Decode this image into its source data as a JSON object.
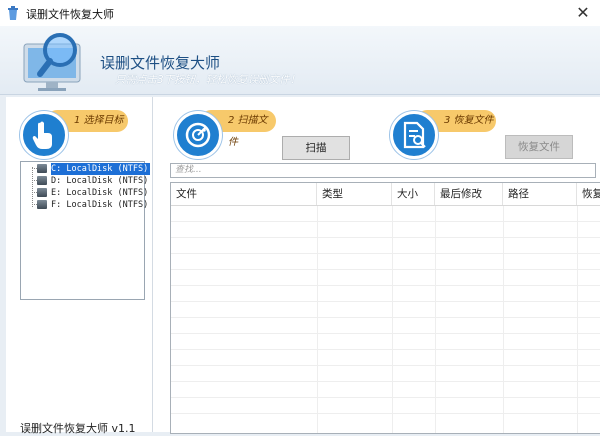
{
  "window": {
    "title": "误删文件恢复大师",
    "close_glyph": "✕"
  },
  "header": {
    "title": "误删文件恢复大师",
    "subtitle": "只需点击3下按钮，轻松恢复误删文件！"
  },
  "steps": [
    {
      "label": "1 选择目标",
      "icon": "hand-pointer-icon"
    },
    {
      "label": "2 扫描文件",
      "icon": "scan-target-icon"
    },
    {
      "label": "3 恢复文件",
      "icon": "document-search-icon"
    }
  ],
  "drives": [
    {
      "label": "C: LocalDisk (NTFS)",
      "selected": true
    },
    {
      "label": "D: LocalDisk (NTFS)",
      "selected": false
    },
    {
      "label": "E: LocalDisk (NTFS)",
      "selected": false
    },
    {
      "label": "F: LocalDisk (NTFS)",
      "selected": false
    }
  ],
  "buttons": {
    "scan": "扫描",
    "restore": "恢复文件"
  },
  "search": {
    "placeholder": "查找..."
  },
  "table": {
    "columns": [
      "文件",
      "类型",
      "大小",
      "最后修改",
      "路径",
      "恢复"
    ]
  },
  "footer": {
    "version": "误删文件恢复大师 v1.1"
  },
  "colors": {
    "accent_blue": "#1f7fd0",
    "step_pill": "#f7c96b",
    "header_title": "#1d4f84",
    "selection": "#1d6fd6"
  }
}
